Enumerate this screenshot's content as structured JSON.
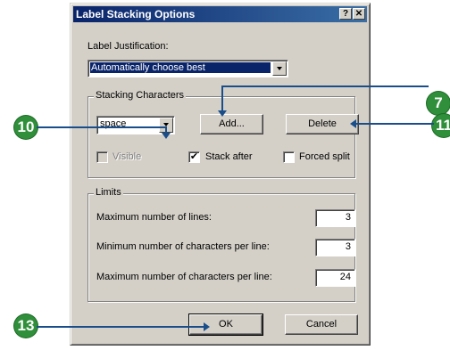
{
  "window": {
    "title": "Label Stacking Options",
    "help_btn": "?",
    "close_btn": "✕"
  },
  "justification": {
    "label": "Label Justification:",
    "value": "Automatically choose best"
  },
  "stacking": {
    "group_label": "Stacking Characters",
    "char_value": "space",
    "add_label": "Add...",
    "delete_label": "Delete",
    "visible_label": "Visible",
    "visible_checked": false,
    "stack_after_label": "Stack after",
    "stack_after_checked": true,
    "forced_split_label": "Forced split",
    "forced_split_checked": false
  },
  "limits": {
    "group_label": "Limits",
    "max_lines_label": "Maximum number of lines:",
    "max_lines": "3",
    "min_chars_label": "Minimum number of characters per line:",
    "min_chars": "3",
    "max_chars_label": "Maximum number of characters per line:",
    "max_chars": "24"
  },
  "buttons": {
    "ok": "OK",
    "cancel": "Cancel"
  },
  "callouts": {
    "c7": "7",
    "c10": "10",
    "c11": "11",
    "c13": "13"
  },
  "colors": {
    "callout": "#2f8f3a",
    "pointer": "#1a4e8a",
    "titlebar": "#0a246a"
  }
}
